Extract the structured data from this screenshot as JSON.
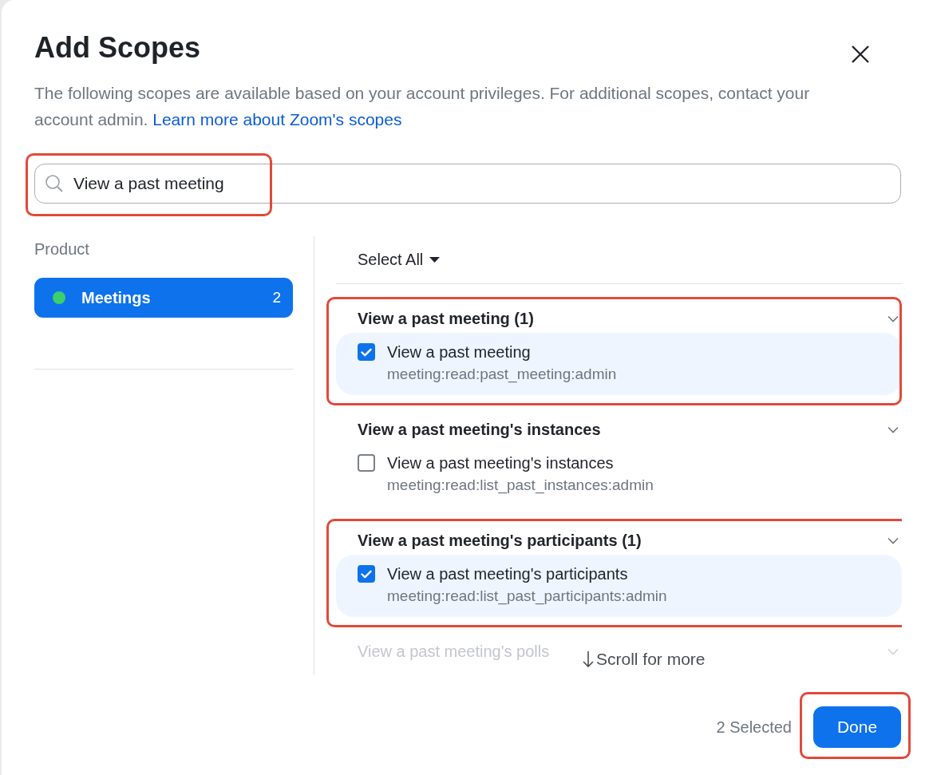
{
  "dialog": {
    "title": "Add Scopes",
    "description": "The following scopes are available based on your account privileges. For additional scopes, contact your account admin.",
    "learn_more_link": "Learn more about Zoom's scopes"
  },
  "search": {
    "value": "View a past meeting",
    "highlighted": true
  },
  "products": {
    "heading": "Product",
    "items": [
      {
        "name": "Meetings",
        "count": "2",
        "color": "#3ccf6b",
        "selected": true
      }
    ]
  },
  "select_all": "Select All",
  "scope_groups": [
    {
      "title": "View a past meeting (1)",
      "highlighted": true,
      "faded": false,
      "scopes": [
        {
          "label": "View a past meeting",
          "scope": "meeting:read:past_meeting:admin",
          "checked": true
        }
      ]
    },
    {
      "title": "View a past meeting's instances",
      "highlighted": false,
      "faded": false,
      "scopes": [
        {
          "label": "View a past meeting's instances",
          "scope": "meeting:read:list_past_instances:admin",
          "checked": false
        }
      ]
    },
    {
      "title": "View a past meeting's participants (1)",
      "highlighted": true,
      "faded": false,
      "scopes": [
        {
          "label": "View a past meeting's participants",
          "scope": "meeting:read:list_past_participants:admin",
          "checked": true
        }
      ]
    },
    {
      "title": "View a past meeting's polls",
      "highlighted": false,
      "faded": true
    }
  ],
  "scroll_hint": "Scroll for more",
  "footer": {
    "selected_count": "2 Selected",
    "done_button": {
      "label": "Done",
      "highlighted": true
    }
  }
}
